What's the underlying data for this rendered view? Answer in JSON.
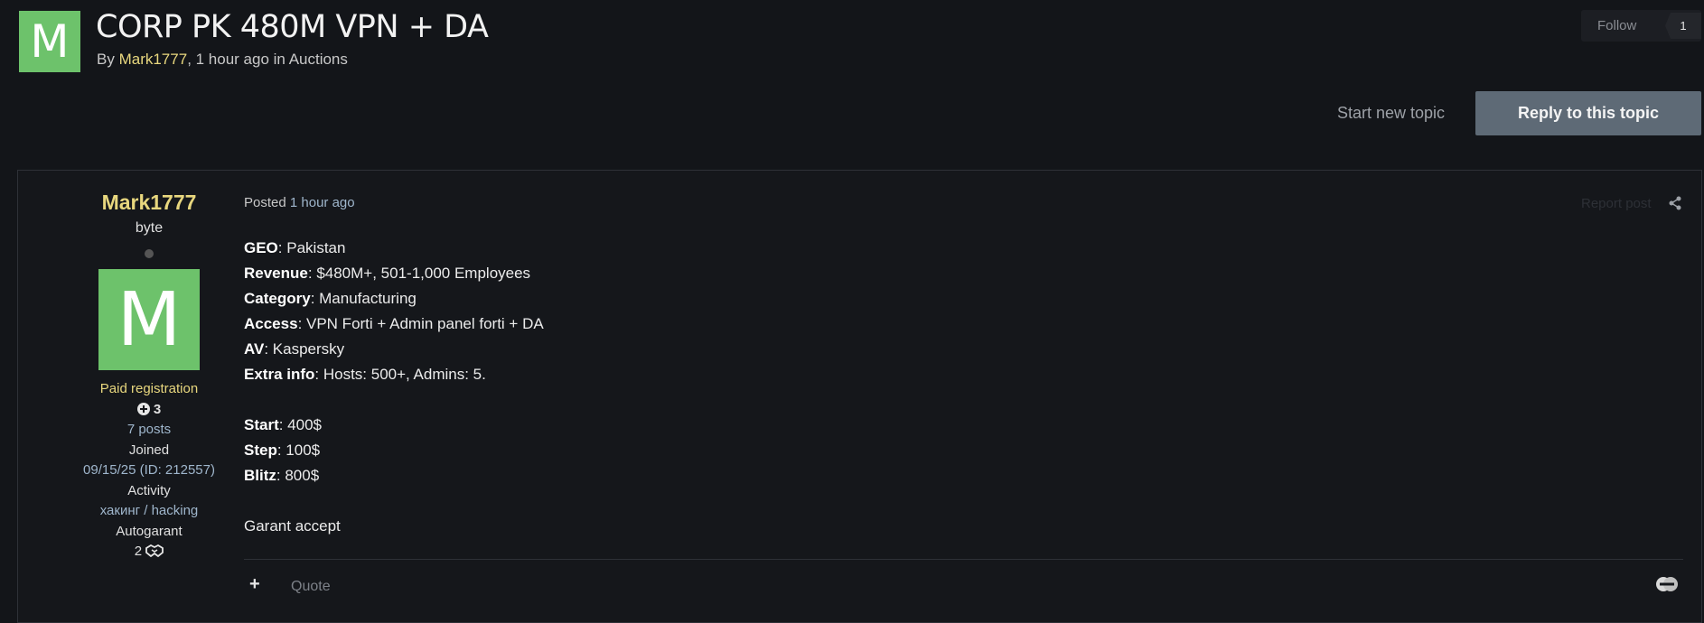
{
  "topic": {
    "avatar_letter": "M",
    "title": "CORP PK 480M VPN + DA",
    "by_label": "By",
    "author": "Mark1777",
    "time_text": ", 1 hour ago in",
    "forum": "Auctions"
  },
  "follow": {
    "label": "Follow",
    "count": "1"
  },
  "actions": {
    "start_new_topic": "Start new topic",
    "reply": "Reply to this topic"
  },
  "post": {
    "author": {
      "name": "Mark1777",
      "title": "byte",
      "avatar_letter": "M",
      "group": "Paid registration",
      "reputation": "3",
      "posts": "7 posts",
      "joined_label": "Joined",
      "joined_value": "09/15/25 (ID: 212557)",
      "activity_label": "Activity",
      "activity_value": "хакинг / hacking",
      "autogarant_label": "Autogarant",
      "autogarant_value": "2"
    },
    "posted_label": "Posted",
    "posted_time": "1 hour ago",
    "report_label": "Report post",
    "content": {
      "geo_key": "GEO",
      "geo_val": ": Pakistan",
      "revenue_key": "Revenue",
      "revenue_val": ": $480M+, 501-1,000 Employees",
      "category_key": "Category",
      "category_val": ": Manufacturing",
      "access_key": "Access",
      "access_val": ": VPN Forti + Admin panel forti + DA",
      "av_key": "AV",
      "av_val": ": Kaspersky",
      "extra_key": "Extra info",
      "extra_val": ": Hosts: 500+, Admins: 5.",
      "start_key": "Start",
      "start_val": ": 400$",
      "step_key": "Step",
      "step_val": ": 100$",
      "blitz_key": "Blitz",
      "blitz_val": ": 800$",
      "closing": "Garant accept"
    },
    "footer": {
      "plus": "+",
      "quote": "Quote"
    }
  },
  "colors": {
    "accent_user": "#e8d77e",
    "avatar_bg": "#6dc26b",
    "reply_bg": "#5e6a76"
  }
}
